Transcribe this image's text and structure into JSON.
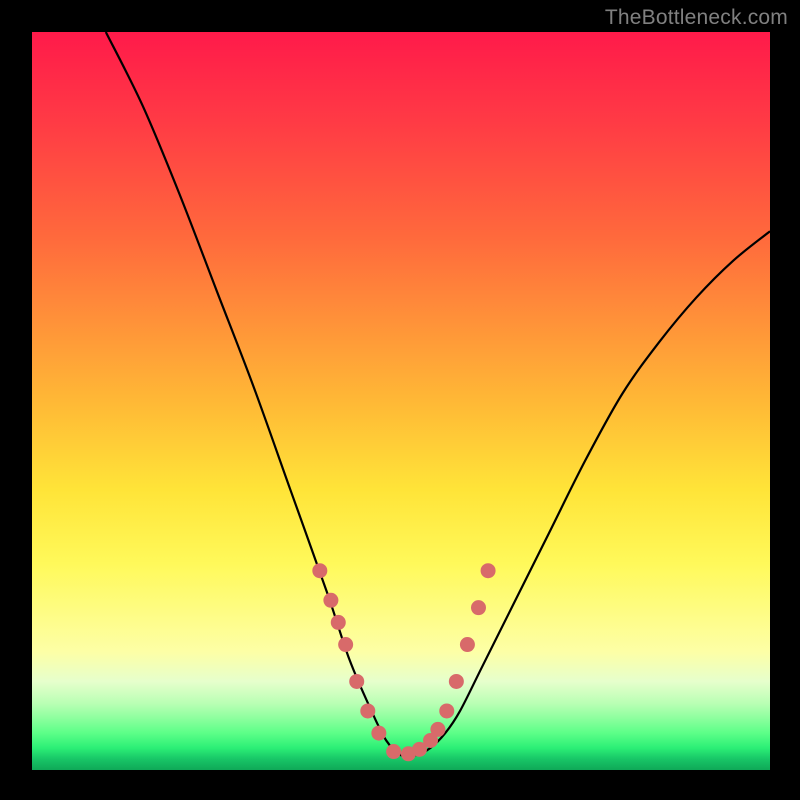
{
  "watermark": "TheBottleneck.com",
  "chart_data": {
    "type": "line",
    "title": "",
    "xlabel": "",
    "ylabel": "",
    "xlim": [
      0,
      100
    ],
    "ylim": [
      0,
      100
    ],
    "grid": false,
    "legend": false,
    "series": [
      {
        "name": "bottleneck-curve",
        "x": [
          10,
          15,
          20,
          25,
          30,
          35,
          40,
          43,
          46,
          48,
          50,
          52,
          54,
          56,
          58,
          61,
          65,
          70,
          75,
          80,
          85,
          90,
          95,
          100
        ],
        "y": [
          100,
          90,
          78,
          65,
          52,
          38,
          24,
          15,
          8,
          4,
          2,
          2,
          3,
          5,
          8,
          14,
          22,
          32,
          42,
          51,
          58,
          64,
          69,
          73
        ]
      }
    ],
    "markers": {
      "name": "highlight-points",
      "color": "#d86a6a",
      "x": [
        39,
        40.5,
        41.5,
        42.5,
        44,
        45.5,
        47,
        49,
        51,
        52.5,
        54,
        55,
        56.2,
        57.5,
        59,
        60.5,
        61.8
      ],
      "y": [
        27,
        23,
        20,
        17,
        12,
        8,
        5,
        2.5,
        2.2,
        2.8,
        4,
        5.5,
        8,
        12,
        17,
        22,
        27
      ]
    },
    "background_gradient": {
      "top": "#ff1a4a",
      "mid": "#ffe438",
      "bottom": "#0fa857"
    }
  }
}
